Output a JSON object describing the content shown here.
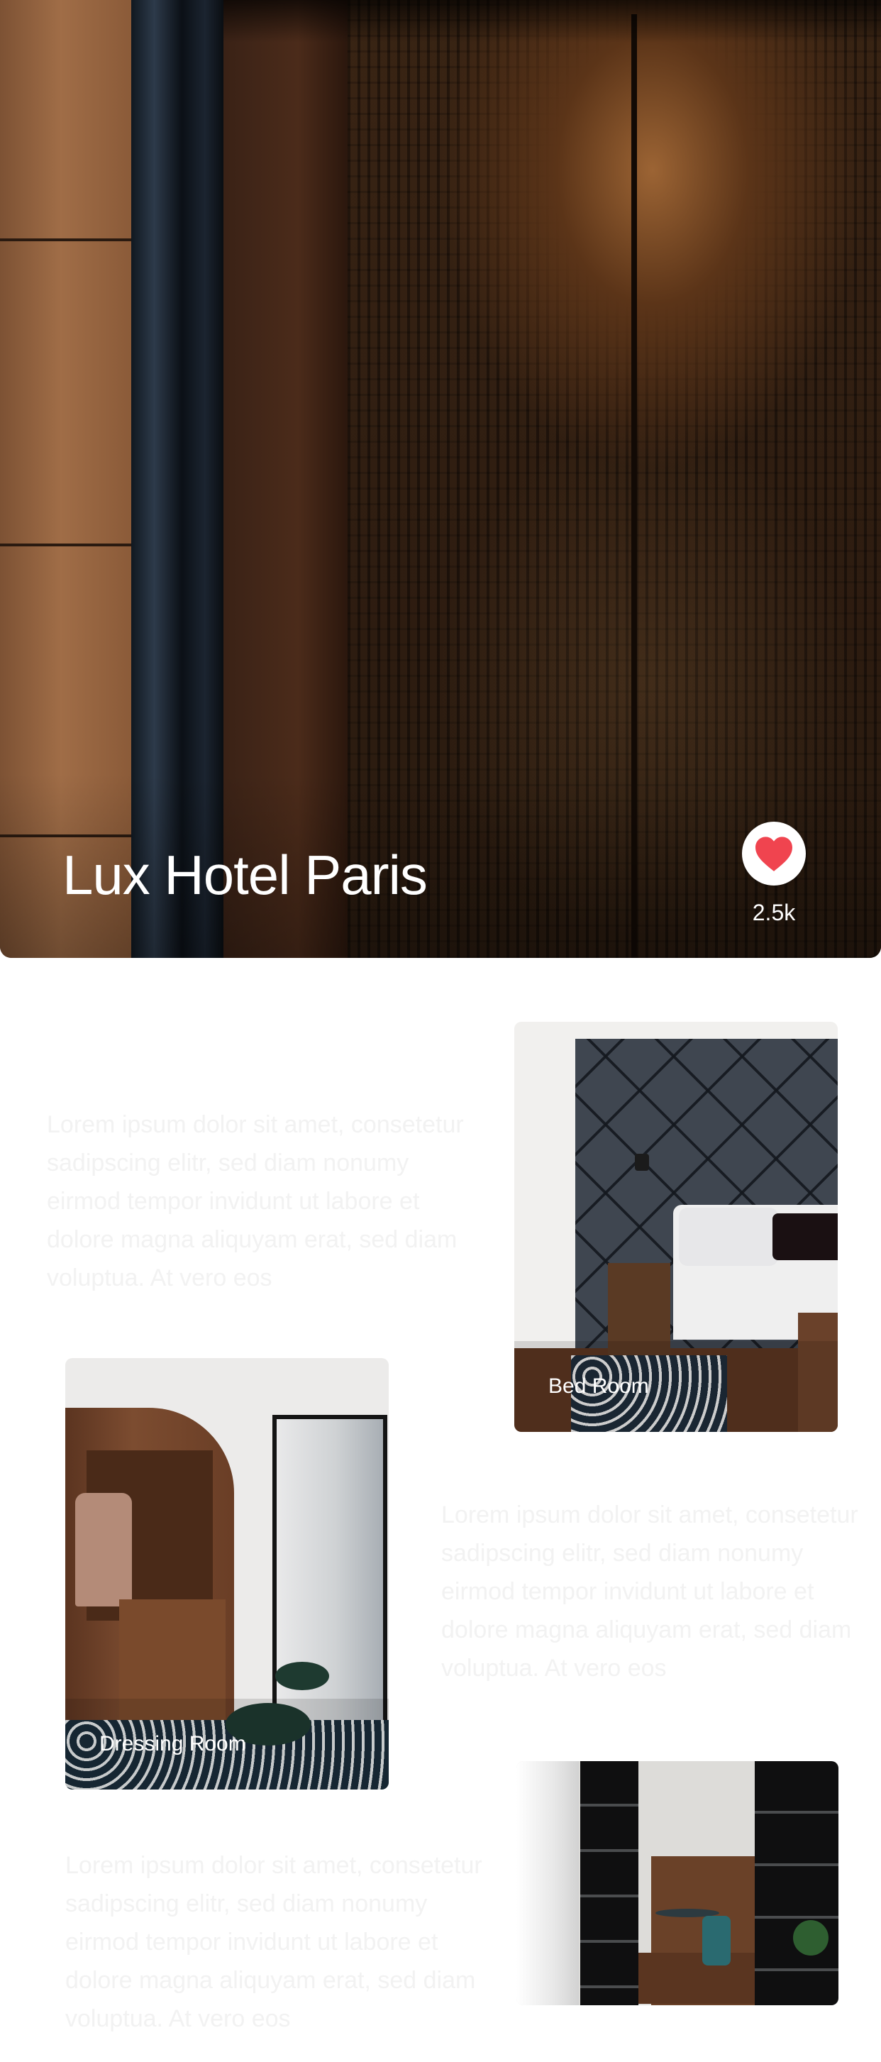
{
  "hero": {
    "title": "Lux Hotel Paris",
    "like_count": "2.5k",
    "like_icon": "heart-icon",
    "accent_color": "#f0444f"
  },
  "paragraphs": [
    {
      "text": "Lorem ipsum dolor sit amet, consetetur sadipscing elitr, sed diam nonumy eirmod tempor invidunt ut labore et dolore magna aliquyam erat, sed diam voluptua. At vero eos"
    },
    {
      "text": "Lorem ipsum dolor sit amet, consetetur sadipscing elitr, sed diam nonumy eirmod tempor invidunt ut labore et dolore magna aliquyam erat, sed diam voluptua. At vero eos"
    },
    {
      "text": "Lorem ipsum dolor sit amet, consetetur sadipscing elitr, sed diam nonumy eirmod tempor invidunt ut labore et dolore magna aliquyam erat, sed diam voluptua. At vero eos"
    }
  ],
  "rooms": [
    {
      "label": "Bed Room"
    },
    {
      "label": "Dressing Room"
    },
    {
      "label": ""
    }
  ]
}
